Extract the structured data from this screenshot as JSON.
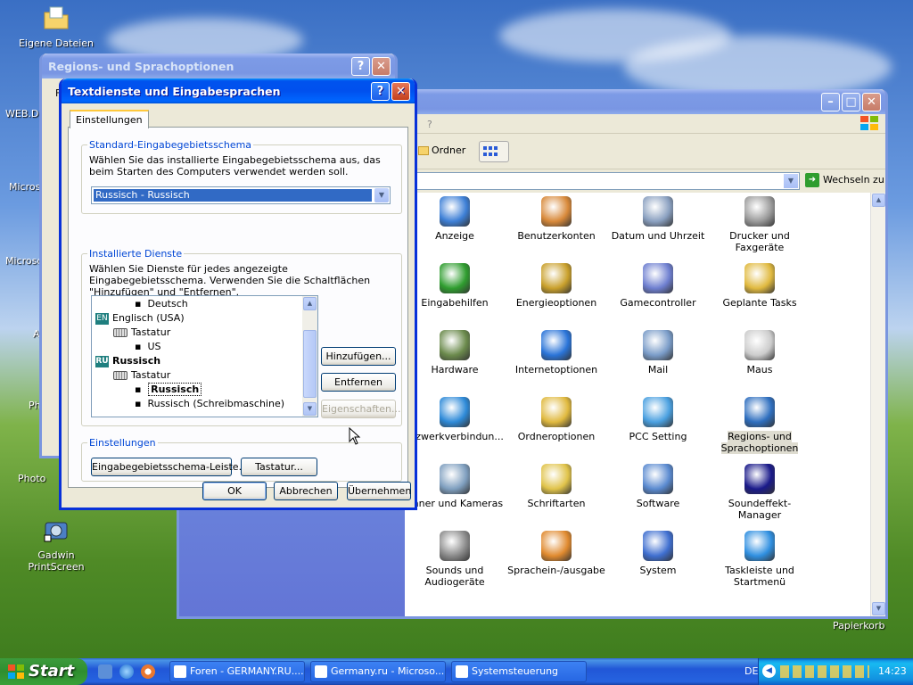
{
  "desktop": {
    "icons": {
      "my_documents": "Eigene Dateien",
      "gadwin": "Gadwin PrintScreen",
      "recycle_bin": "Papierkorb"
    },
    "partial_labels": [
      "WEB.DE",
      "Microso",
      "Microsof",
      "Al",
      "Ph",
      "Photo"
    ]
  },
  "control_panel": {
    "help_mark": "?",
    "toolbar_folders": "Ordner",
    "go_label": "Wechseln zu",
    "items": [
      {
        "label": "Anzeige",
        "icon": "display-icon"
      },
      {
        "label": "Benutzerkonten",
        "icon": "users-icon"
      },
      {
        "label": "Datum und Uhrzeit",
        "icon": "clock-icon"
      },
      {
        "label": "Drucker und Faxgeräte",
        "icon": "printer-icon"
      },
      {
        "label": "Eingabehilfen",
        "icon": "accessibility-icon"
      },
      {
        "label": "Energieoptionen",
        "icon": "power-icon"
      },
      {
        "label": "Gamecontroller",
        "icon": "gamepad-icon"
      },
      {
        "label": "Geplante Tasks",
        "icon": "scheduled-tasks-icon"
      },
      {
        "label": "Hardware",
        "icon": "hardware-icon"
      },
      {
        "label": "Internetoptionen",
        "icon": "globe-icon"
      },
      {
        "label": "Mail",
        "icon": "mail-icon"
      },
      {
        "label": "Maus",
        "icon": "mouse-icon"
      },
      {
        "label": "etzwerkverbindun...",
        "icon": "network-icon"
      },
      {
        "label": "Ordneroptionen",
        "icon": "folder-options-icon"
      },
      {
        "label": "PCC Setting",
        "icon": "pcc-icon"
      },
      {
        "label": "Regions- und Sprachoptionen",
        "icon": "regional-icon",
        "selected": true
      },
      {
        "label": "anner und Kameras",
        "icon": "scanner-icon"
      },
      {
        "label": "Schriftarten",
        "icon": "fonts-icon"
      },
      {
        "label": "Software",
        "icon": "software-icon"
      },
      {
        "label": "Soundeffekt-Manager",
        "icon": "sound-effect-icon"
      },
      {
        "label": "Sounds und Audiogeräte",
        "icon": "speaker-icon"
      },
      {
        "label": "Sprachein-/ausgabe",
        "icon": "speech-icon"
      },
      {
        "label": "System",
        "icon": "system-icon"
      },
      {
        "label": "Taskleiste und Startmenü",
        "icon": "taskbar-icon"
      }
    ]
  },
  "regional_dialog": {
    "title": "Regions- und Sprachoptionen",
    "help": "?",
    "close": "✕",
    "tab_partial": "F"
  },
  "text_services_dialog": {
    "title": "Textdienste und Eingabesprachen",
    "help": "?",
    "close": "✕",
    "tab": "Einstellungen",
    "default_group": {
      "legend": "Standard-Eingabegebietsschema",
      "text": "Wählen Sie das installierte Eingabegebietsschema aus, das beim Starten des Computers verwendet werden soll.",
      "selected": "Russisch - Russisch"
    },
    "installed_group": {
      "legend": "Installierte Dienste",
      "text": "Wählen Sie Dienste für jedes angezeigte Eingabegebietsschema. Verwenden Sie die Schaltflächen \"Hinzufügen\" und \"Entfernen\".",
      "tree": {
        "deutsch": "Deutsch",
        "en_badge": "EN",
        "english": "Englisch (USA)",
        "keyboard1": "Tastatur",
        "us": "US",
        "ru_badge": "RU",
        "russian": "Russisch",
        "keyboard2": "Tastatur",
        "russian_layout": "Russisch",
        "russian_typewriter": "Russisch (Schreibmaschine)"
      },
      "add": "Hinzufügen...",
      "remove": "Entfernen",
      "properties": "Eigenschaften..."
    },
    "settings_group": {
      "legend": "Einstellungen",
      "language_bar": "Eingabegebietsschema-Leiste...",
      "keyboard": "Tastatur..."
    },
    "ok": "OK",
    "cancel": "Abbrechen",
    "apply": "Übernehmen"
  },
  "taskbar": {
    "start": "Start",
    "tasks": [
      "Foren - GERMANY.RU....",
      "Germany.ru - Microso...",
      "Systemsteuerung"
    ],
    "lang": "DE",
    "clock": "14:23"
  }
}
